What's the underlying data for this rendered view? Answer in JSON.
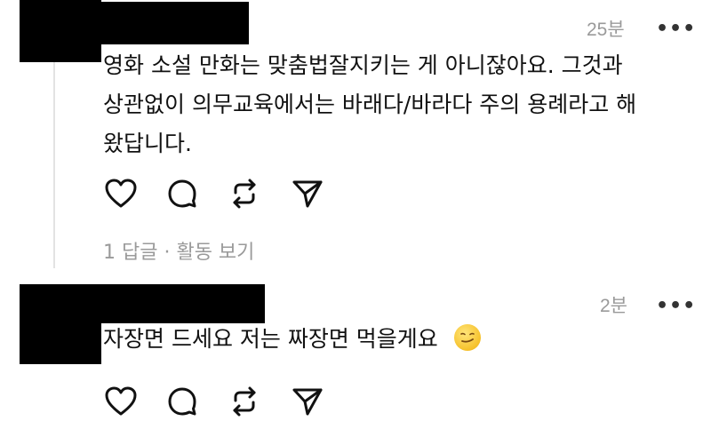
{
  "comments": [
    {
      "time": "25분",
      "more": "•••",
      "lines": [
        "영화 소설 만화는 맞춤법잘지키는 게 아니잖아요. 그것과",
        "상관없이 의무교육에서는 바래다/바라다 주의 용례라고 해",
        "왔답니다."
      ],
      "replies": "1 답글 · 활동 보기"
    },
    {
      "time": "2분",
      "more": "•••",
      "lines": [
        "자장면 드세요 저는 짜장면 먹을게요"
      ],
      "emoji": "smirking-face-emoji"
    }
  ],
  "actions": [
    "heart-icon",
    "comment-icon",
    "repost-icon",
    "share-icon"
  ],
  "colors": {
    "meta": "#9a9a9a",
    "text": "#111111",
    "redaction": "#000000"
  }
}
